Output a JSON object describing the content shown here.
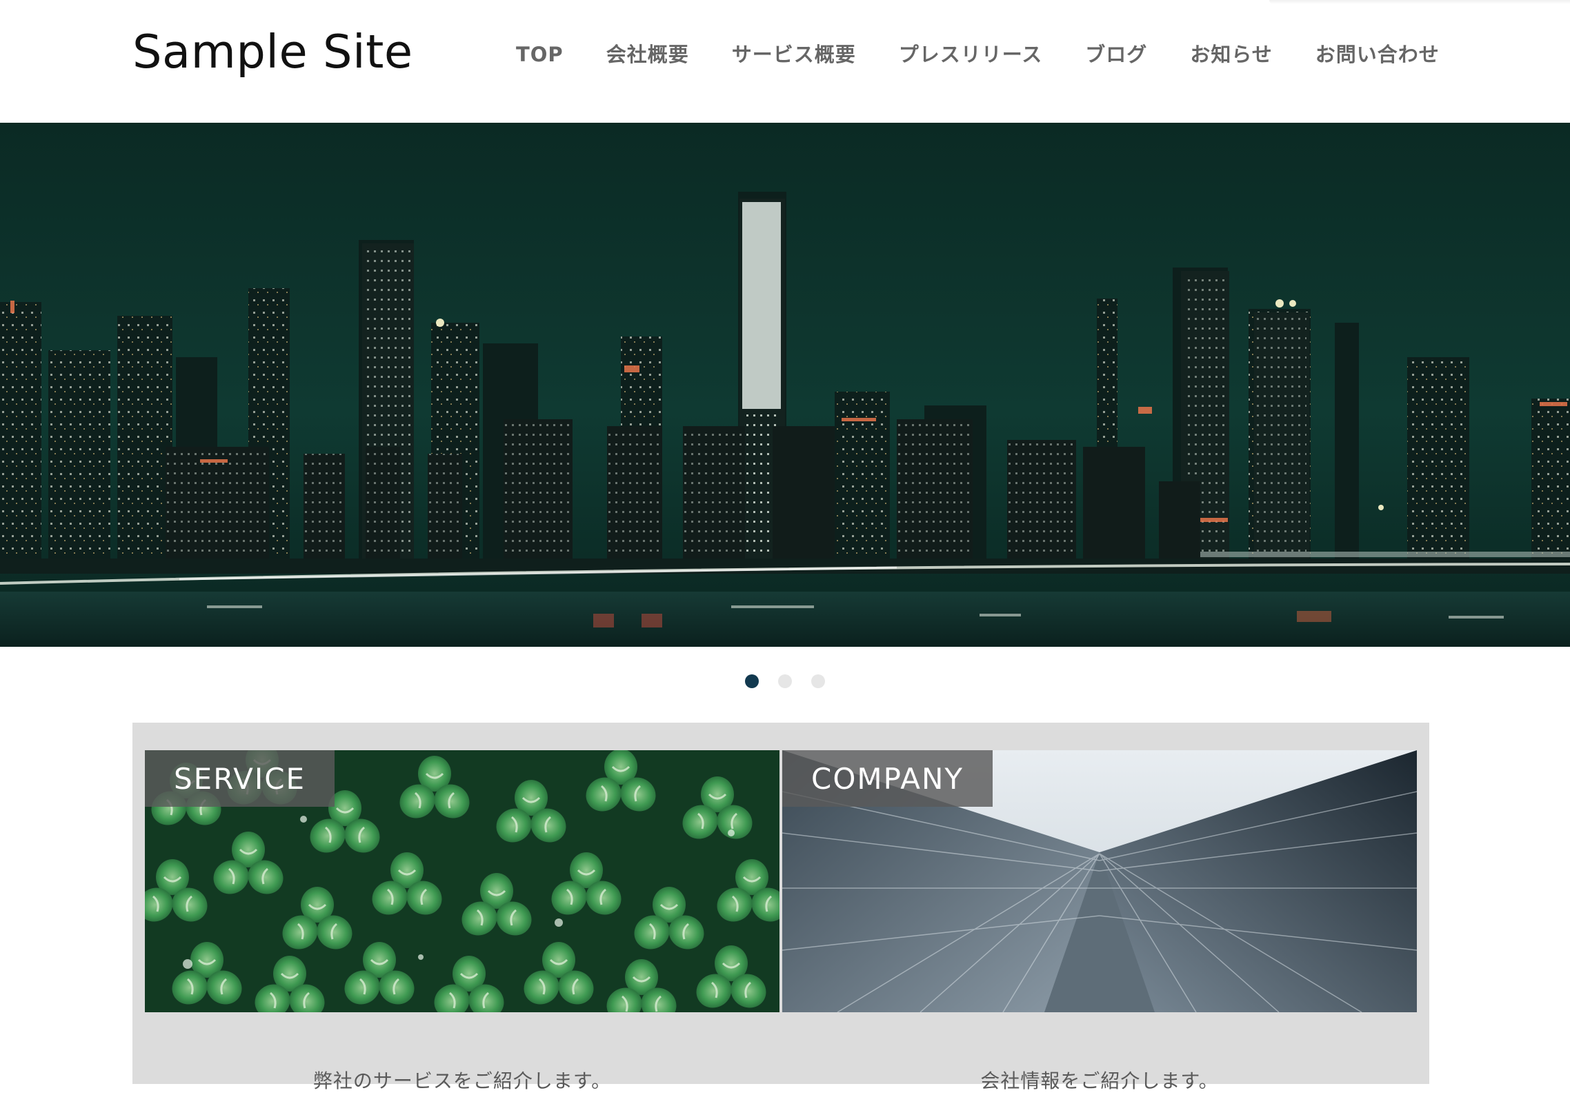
{
  "header": {
    "site_title": "Sample Site",
    "nav": [
      {
        "label": "TOP"
      },
      {
        "label": "会社概要"
      },
      {
        "label": "サービス概要"
      },
      {
        "label": "プレスリリース"
      },
      {
        "label": "ブログ"
      },
      {
        "label": "お知らせ"
      },
      {
        "label": "お問い合わせ"
      }
    ]
  },
  "hero": {
    "image": "night-city-skyline",
    "slide_count": 3,
    "active_slide": 1
  },
  "cards": [
    {
      "label": "SERVICE",
      "image": "clover-leaves",
      "description": "弊社のサービスをご紹介します。"
    },
    {
      "label": "COMPANY",
      "image": "glass-skyscraper",
      "description": "会社情報をご紹介します。"
    }
  ],
  "colors": {
    "background": "#ffffff",
    "nav_text": "#666666",
    "dot_active": "#12394f",
    "dot_inactive": "#e6e6e6",
    "cards_background": "#dcdcdc",
    "card_label_bg": "#5a5a5a"
  }
}
